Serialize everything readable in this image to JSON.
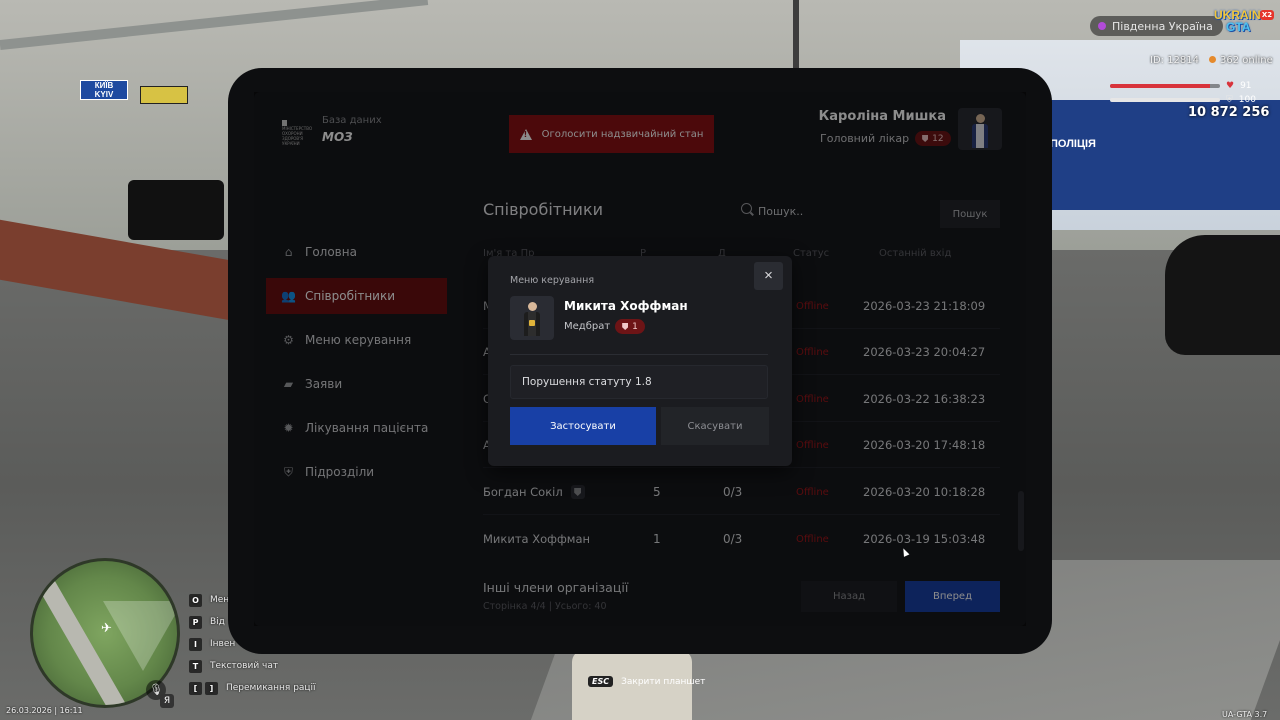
{
  "hud": {
    "region": "Південна Україна",
    "logo_line1": "UKRAIN",
    "logo_line2": "GTA",
    "logo_badge": "X2",
    "player_id": "ID: 12814",
    "online": "362 online",
    "health_value": "91",
    "armor_value": "100",
    "health_level": 0.91,
    "armor_level": 1.0,
    "money": "10 872 256",
    "datetime": "26.03.2026 | 16:11",
    "version": "UA-GTA 3.7",
    "mic_lang": "Я",
    "esc_key": "ESC",
    "esc_label": "Закрити планшет",
    "hotkeys": [
      {
        "key": "O",
        "label": "Мен"
      },
      {
        "key": "P",
        "label": "Від"
      },
      {
        "key": "I",
        "label": "Інвен"
      },
      {
        "key": "T",
        "label": "Текстовий чат"
      }
    ],
    "hotkey_last": {
      "key1": "[",
      "key2": "]",
      "label": "Перемикання рації"
    },
    "background": {
      "sign_line1": "КИЇВ",
      "sign_line2": "KYIV",
      "police": "ПОЛІЦІЯ"
    }
  },
  "tablet": {
    "db_label": "База даних",
    "db_name": "МОЗ",
    "ministry_logo_text": "МІНІСТЕРСТВО ОХОРОНИ ЗДОРОВ'Я УКРАЇНИ",
    "emergency_button": "Оголосити надзвичайний стан",
    "user": {
      "name": "Кароліна Мишка",
      "role": "Головний лікар",
      "rank": "12"
    },
    "nav": [
      {
        "label": "Головна",
        "icon": "home-icon"
      },
      {
        "label": "Співробітники",
        "icon": "users-icon",
        "active": true
      },
      {
        "label": "Меню керування",
        "icon": "gear-icon"
      },
      {
        "label": "Заяви",
        "icon": "folder-icon"
      },
      {
        "label": "Лікування пацієнта",
        "icon": "virus-icon"
      },
      {
        "label": "Підрозділи",
        "icon": "shield-icon"
      }
    ],
    "page_title": "Співробітники",
    "search_placeholder": "Пошук..",
    "search_button": "Пошук",
    "columns": {
      "c1": "Ім'я та Пр",
      "c2": "Р",
      "c3": "Д",
      "status": "Статус",
      "last_login": "Останній вхід"
    },
    "rows": [
      {
        "name": "М",
        "rank": "",
        "warns": "",
        "status": "Offline",
        "last_login": "2026-03-23 21:18:09"
      },
      {
        "name": "А",
        "rank": "",
        "warns": "",
        "status": "Offline",
        "last_login": "2026-03-23 20:04:27"
      },
      {
        "name": "С",
        "rank": "",
        "warns": "",
        "status": "Offline",
        "last_login": "2026-03-22 16:38:23"
      },
      {
        "name": "А",
        "rank": "",
        "warns": "",
        "status": "Offline",
        "last_login": "2026-03-20 17:48:18"
      },
      {
        "name": "Богдан Сокіл",
        "rank": "5",
        "warns": "0/3",
        "status": "Offline",
        "last_login": "2026-03-20 10:18:28"
      },
      {
        "name": "Микита Хоффман",
        "rank": "1",
        "warns": "0/3",
        "status": "Offline",
        "last_login": "2026-03-19 15:03:48"
      }
    ],
    "footer_title": "Інші члени організації",
    "footer_sub": "Сторінка 4/4 | Усього: 40",
    "back_button": "Назад",
    "next_button": "Вперед"
  },
  "modal": {
    "title": "Меню керування",
    "close": "×",
    "name": "Микита Хоффман",
    "role": "Медбрат",
    "rank": "1",
    "reason_value": "Порушення статуту 1.8",
    "apply_button": "Застосувати",
    "cancel_button": "Скасувати"
  },
  "colors": {
    "accent_red": "#6a1012",
    "accent_blue": "#1840a6",
    "status_offline": "#a2171c"
  }
}
